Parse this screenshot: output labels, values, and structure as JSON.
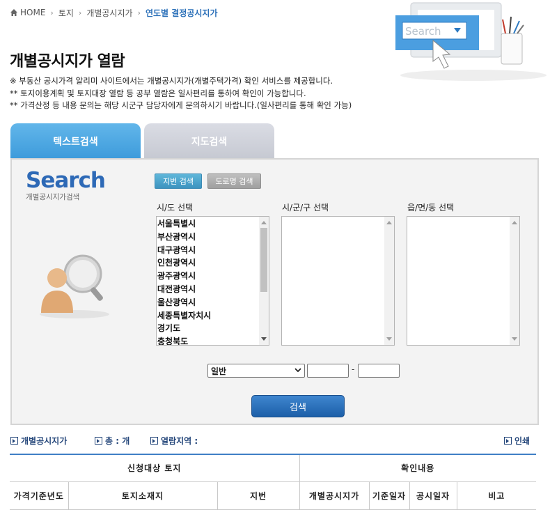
{
  "breadcrumb": {
    "home": "HOME",
    "items": [
      "토지",
      "개별공시지가"
    ],
    "current": "연도별 결정공시지가"
  },
  "hero": {
    "search_text": "Search"
  },
  "page_title": "개별공시지가 열람",
  "notices": [
    "※ 부동산 공시가격 알리미 사이트에서는 개별공시지가(개별주택가격) 확인 서비스를 제공합니다.",
    "** 토지이용계획 및 토지대장 열람 등 공부 열람은 일사편리를 통하여 확인이 가능합니다.",
    "** 가격산정 등 내용 문의는 해당 시군구 담당자에게 문의하시기 바랍니다.(일사편리를 통해 확인 가능)"
  ],
  "tabs": {
    "text_search": "텍스트검색",
    "map_search": "지도검색"
  },
  "search_panel": {
    "logo_big": "Search",
    "logo_small": "개별공시지가검색",
    "btn_lot": "지번 검색",
    "btn_road": "도로명 검색",
    "sido_label": "시/도 선택",
    "sigungu_label": "시/군/구 선택",
    "eupmyeondong_label": "읍/면/동 선택",
    "sido_options": [
      "서울특별시",
      "부산광역시",
      "대구광역시",
      "인천광역시",
      "광주광역시",
      "대전광역시",
      "울산광역시",
      "세종특별자치시",
      "경기도",
      "충청북도"
    ],
    "land_type": "일반",
    "dash": "-",
    "search_button": "검색"
  },
  "info": {
    "title": "개별공시지가",
    "total": "총 : 개",
    "region": "열람지역 :",
    "print": "인쇄"
  },
  "table": {
    "group1": "신청대상 토지",
    "group2": "확인내용",
    "columns": [
      "가격기준년도",
      "토지소재지",
      "지번",
      "개별공시지가",
      "기준일자",
      "공시일자",
      "비고"
    ]
  },
  "colors": {
    "accent": "#3d9bdb",
    "link": "#24467a",
    "current_crumb": "#2a6fb8",
    "search_button": "#1c5fa8"
  }
}
